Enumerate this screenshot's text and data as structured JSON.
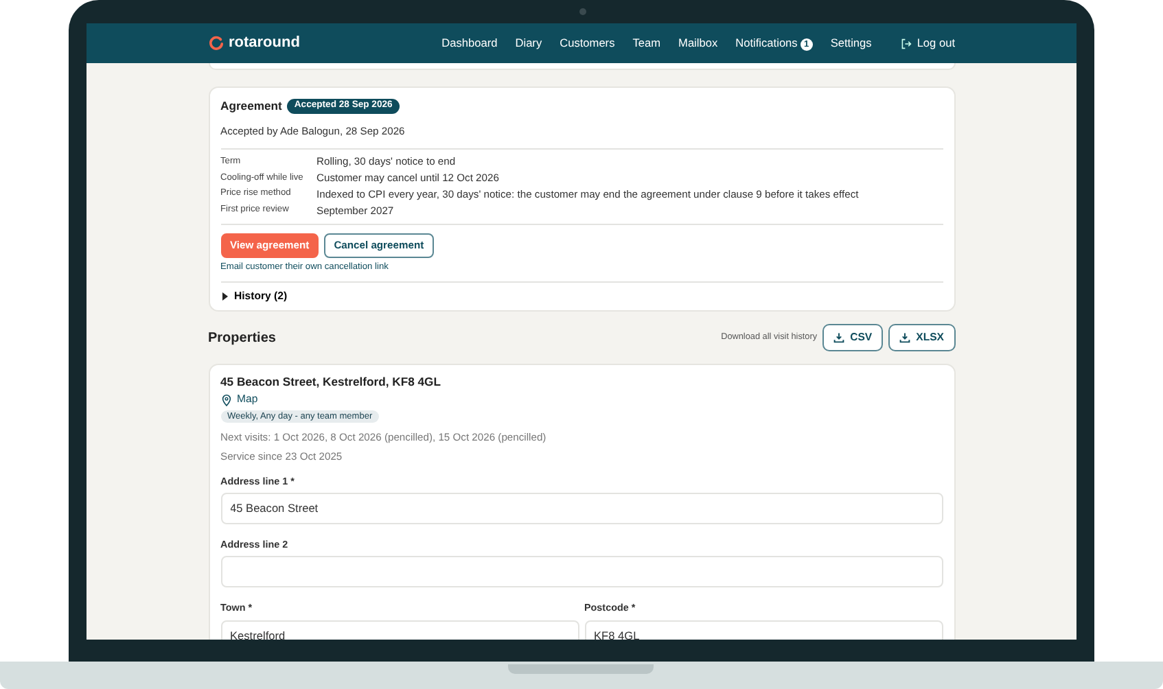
{
  "header": {
    "logo": "rotaround",
    "nav": [
      {
        "label": "Dashboard"
      },
      {
        "label": "Diary"
      },
      {
        "label": "Customers"
      },
      {
        "label": "Team"
      },
      {
        "label": "Mailbox"
      },
      {
        "label": "Notifications",
        "badge": "1"
      },
      {
        "label": "Settings"
      }
    ],
    "logout": "Log out"
  },
  "agreement": {
    "title": "Agreement",
    "status": "Accepted 28 Sep 2026",
    "accepted_by": "Accepted by Ade Balogun, 28 Sep 2026",
    "terms": [
      {
        "label": "Term",
        "value": "Rolling, 30 days' notice to end"
      },
      {
        "label": "Cooling-off while live",
        "value": "Customer may cancel until 12 Oct 2026"
      },
      {
        "label": "Price rise method",
        "value": "Indexed to CPI every year, 30 days' notice: the customer may end the agreement under clause 9 before it takes effect"
      },
      {
        "label": "First price review",
        "value": "September 2027"
      }
    ],
    "buttons": [
      {
        "label": "View agreement",
        "kind": "primary"
      },
      {
        "label": "Cancel agreement",
        "kind": "outline"
      }
    ],
    "cancel_link": "Email customer their own cancellation link",
    "history": {
      "label": "History (2)",
      "expanded": false
    }
  },
  "properties": {
    "title": "Properties",
    "download_label": "Download all visit history",
    "downloads": [
      "CSV",
      "XLSX"
    ],
    "items": [
      {
        "address": "45 Beacon Street, Kestrelford, KF8 4GL",
        "map": "Map",
        "schedule": "Weekly, Any day - any team member",
        "next_visits": "Next visits: 1 Oct 2026, 8 Oct 2026 (pencilled), 15 Oct 2026 (pencilled)",
        "service_since": "Service since 23 Oct 2025",
        "fields": [
          {
            "label": "Address line 1 *",
            "value": "45 Beacon Street",
            "kind": "full"
          },
          {
            "label": "Address line 2",
            "kind": "full"
          },
          {
            "label": "Town *",
            "value": "Kestrelford",
            "kind": "half"
          },
          {
            "label": "Postcode *",
            "value": "KF8 4GL",
            "kind": "half"
          }
        ]
      }
    ]
  }
}
